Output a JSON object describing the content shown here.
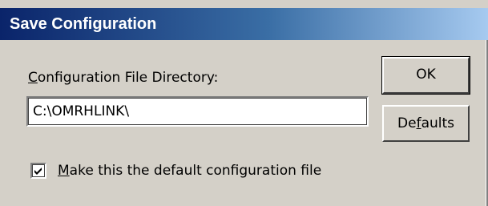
{
  "dialog": {
    "title": "Save Configuration"
  },
  "directory_field": {
    "label_accel": "C",
    "label_rest": "onfiguration File Directory:",
    "value": "C:\\OMRHLINK\\"
  },
  "buttons": {
    "ok_label": "OK",
    "defaults_pre": "De",
    "defaults_accel": "f",
    "defaults_post": "aults"
  },
  "default_checkbox": {
    "checked": true,
    "label_accel": "M",
    "label_rest": "ake this the default configuration file"
  }
}
